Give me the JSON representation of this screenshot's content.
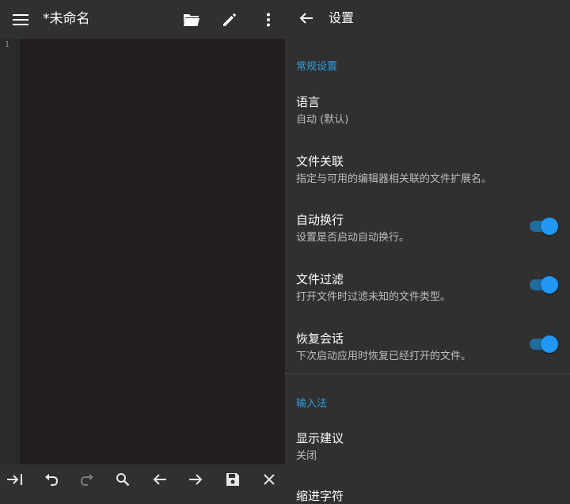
{
  "editor": {
    "title": "*未命名",
    "line_numbers": [
      "1"
    ],
    "toolbar_icons": [
      "menu-icon",
      "folder-open-icon",
      "pencil-icon",
      "more-vert-icon"
    ],
    "bottom_icons": [
      "tab-indent-icon",
      "undo-icon",
      "redo-icon",
      "search-icon",
      "arrow-left-icon",
      "arrow-right-icon",
      "save-icon",
      "close-icon"
    ]
  },
  "settings": {
    "title": "设置",
    "sections": [
      {
        "header": "常规设置",
        "items": [
          {
            "title": "语言",
            "summary": "自动 (默认)",
            "toggle": null
          },
          {
            "title": "文件关联",
            "summary": "指定与可用的编辑器相关联的文件扩展名。",
            "toggle": null
          },
          {
            "title": "自动换行",
            "summary": "设置是否启动自动换行。",
            "toggle": true
          },
          {
            "title": "文件过滤",
            "summary": "打开文件时过滤未知的文件类型。",
            "toggle": true
          },
          {
            "title": "恢复会话",
            "summary": "下次启动应用时恢复已经打开的文件。",
            "toggle": true
          }
        ]
      },
      {
        "header": "输入法",
        "items": [
          {
            "title": "显示建议",
            "summary": "关闭",
            "toggle": null
          },
          {
            "title": "缩进字符",
            "summary": "",
            "toggle": null
          }
        ]
      }
    ]
  },
  "colors": {
    "accent": "#2196f3",
    "section_header": "#2f9fe0",
    "panel_bg": "#303030",
    "editor_bg": "#231f20"
  }
}
